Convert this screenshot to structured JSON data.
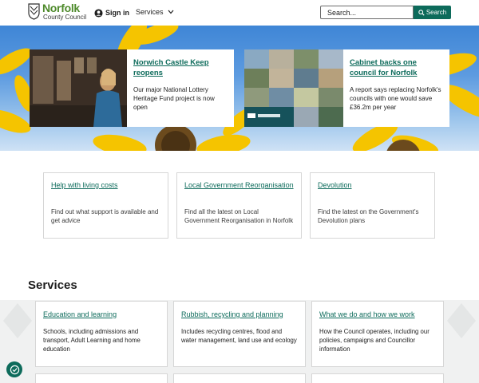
{
  "header": {
    "logo_name": "Norfolk",
    "logo_sub": "County Council",
    "signin_label": "Sign in",
    "services_label": "Services",
    "search_placeholder": "Search...",
    "search_button": "Search"
  },
  "hero": {
    "cards": [
      {
        "title": "Norwich Castle Keep reopens",
        "desc": "Our major National Lottery Heritage Fund project is now open"
      },
      {
        "title": "Cabinet backs one council for Norfolk",
        "desc": "A report says replacing Norfolk's councils with one would save £36.2m per year"
      }
    ]
  },
  "promos": [
    {
      "title": "Help with living costs",
      "desc": "Find out what support is available and get advice"
    },
    {
      "title": "Local Government Reorganisation",
      "desc": "Find all the latest on Local Government Reorganisation in Norfolk"
    },
    {
      "title": "Devolution",
      "desc": "Find the latest on the Government's Devolution plans"
    }
  ],
  "services": {
    "heading": "Services",
    "items": [
      {
        "title": "Education and learning",
        "desc": "Schools, including admissions and transport, Adult Learning and home education"
      },
      {
        "title": "Rubbish, recycling and planning",
        "desc": "Includes recycling centres, flood and water management, land use and ecology"
      },
      {
        "title": "What we do and how we work",
        "desc": "How the Council operates, including our policies, campaigns and Councillor information"
      }
    ]
  },
  "colors": {
    "brand_green": "#4e8a2b",
    "link_teal": "#0d6b5b"
  }
}
